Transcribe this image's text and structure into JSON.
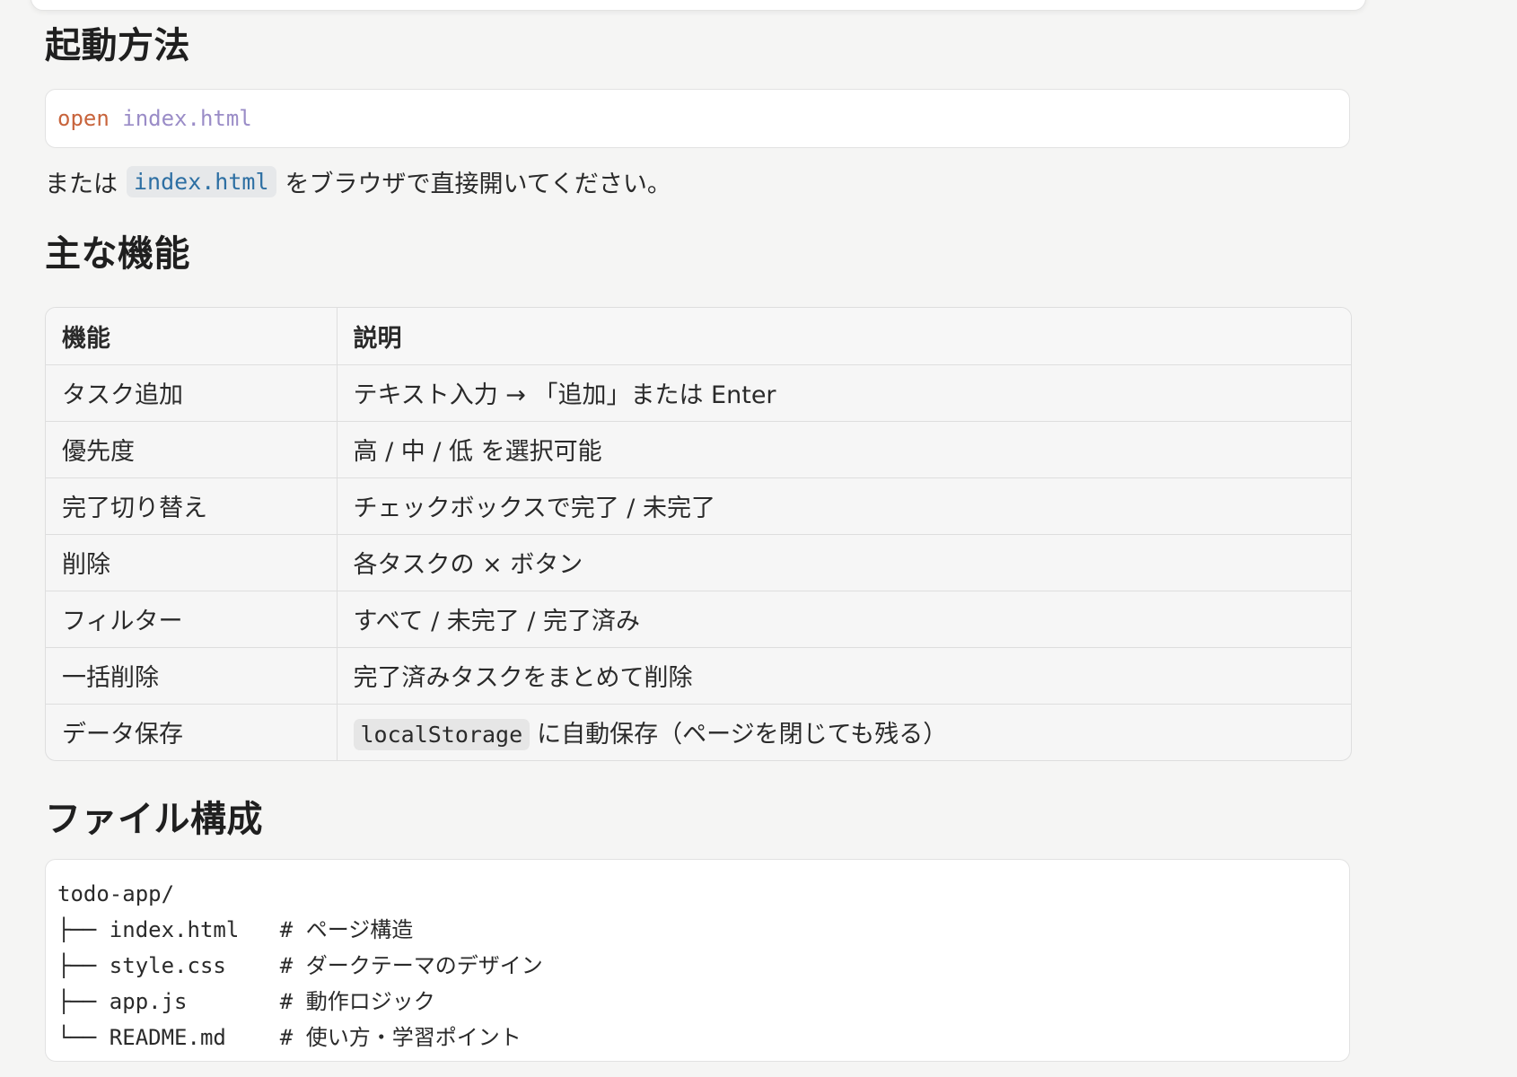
{
  "sections": {
    "start": {
      "heading": "起動方法",
      "command": {
        "keyword": "open",
        "argument": "index.html"
      },
      "note": {
        "prefix": "または",
        "code": "index.html",
        "suffix": "をブラウザで直接開いてください。"
      }
    },
    "features": {
      "heading": "主な機能",
      "table": {
        "headers": [
          "機能",
          "説明"
        ],
        "rows": [
          {
            "feature": "タスク追加",
            "description": "テキスト入力 → 「追加」または Enter"
          },
          {
            "feature": "優先度",
            "description": "高 / 中 / 低 を選択可能"
          },
          {
            "feature": "完了切り替え",
            "description": "チェックボックスで完了 / 未完了"
          },
          {
            "feature": "削除",
            "description": "各タスクの × ボタン"
          },
          {
            "feature": "フィルター",
            "description": "すべて / 未完了 / 完了済み"
          },
          {
            "feature": "一括削除",
            "description": "完了済みタスクをまとめて削除"
          },
          {
            "feature": "データ保存",
            "code": "localStorage",
            "description": "に自動保存（ページを閉じても残る）"
          }
        ]
      }
    },
    "files": {
      "heading": "ファイル構成",
      "root": "todo-app/",
      "entries": [
        {
          "prefix": "├── ",
          "name": "index.html",
          "comment": "# ページ構造"
        },
        {
          "prefix": "├── ",
          "name": "style.css",
          "comment": "# ダークテーマのデザイン"
        },
        {
          "prefix": "├── ",
          "name": "app.js",
          "comment": "# 動作ロジック"
        },
        {
          "prefix": "└── ",
          "name": "README.md",
          "comment": "# 使い方・学習ポイント"
        }
      ]
    }
  }
}
